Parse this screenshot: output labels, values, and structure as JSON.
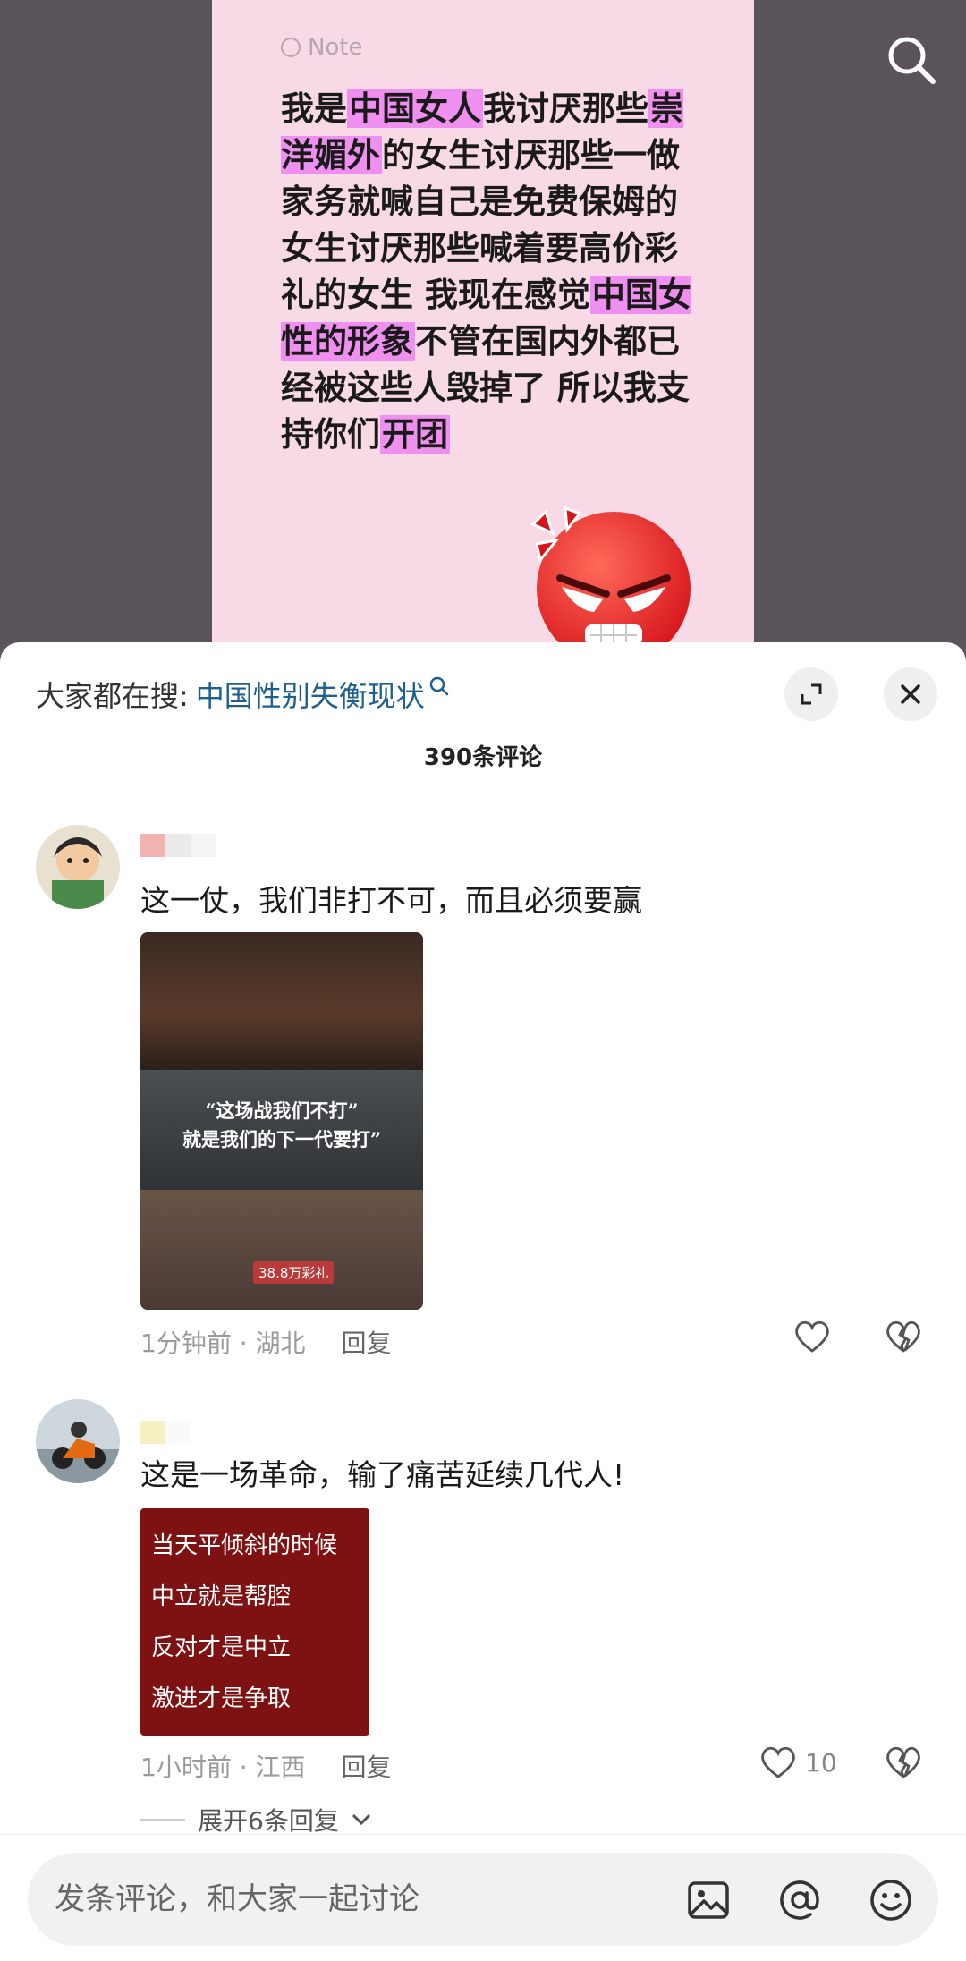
{
  "top": {
    "note_label": "Note",
    "note_segments": [
      {
        "text": "我是",
        "hl": false
      },
      {
        "text": "中国女人",
        "hl": true
      },
      {
        "text": "我讨厌那些",
        "hl": false
      },
      {
        "text": "崇洋媚外",
        "hl": true
      },
      {
        "text": "的女生讨厌那些一做家务就喊自己是免费保姆的女生讨厌那些喊着要高价彩礼的女生 我现在感觉",
        "hl": false
      },
      {
        "text": "中国女性的形象",
        "hl": true
      },
      {
        "text": "不管在国内外都已经被这些人毁掉了 所以我支持你们",
        "hl": false
      },
      {
        "text": "开团",
        "hl": true
      }
    ]
  },
  "sheet": {
    "trending_prefix": "大家都在搜:",
    "trending_query": "中国性别失衡现状",
    "comment_count": "390条评论"
  },
  "comments": [
    {
      "text": "这一仗，我们非打不可，而且必须要赢",
      "image_caption_1": "“这场战我们不打”",
      "image_caption_2": "就是我们的下一代要打”",
      "image_tag": "38.8万彩礼",
      "time_location": "1分钟前 · 湖北",
      "reply_label": "回复",
      "likes": ""
    },
    {
      "text": "这是一场革命，输了痛苦延续几代人!",
      "image_lines": [
        "当天平倾斜的时候",
        "中立就是帮腔",
        "反对才是中立",
        "激进才是争取"
      ],
      "time_location": "1小时前 · 江西",
      "reply_label": "回复",
      "likes": "10",
      "expand_replies": "展开6条回复"
    }
  ],
  "input": {
    "placeholder": "发条评论，和大家一起讨论"
  },
  "colors": {
    "highlight": "#ef8ff0",
    "link": "#1d5f8e",
    "note_bg": "#f8d9e6",
    "quote_bg": "#7e1111"
  }
}
